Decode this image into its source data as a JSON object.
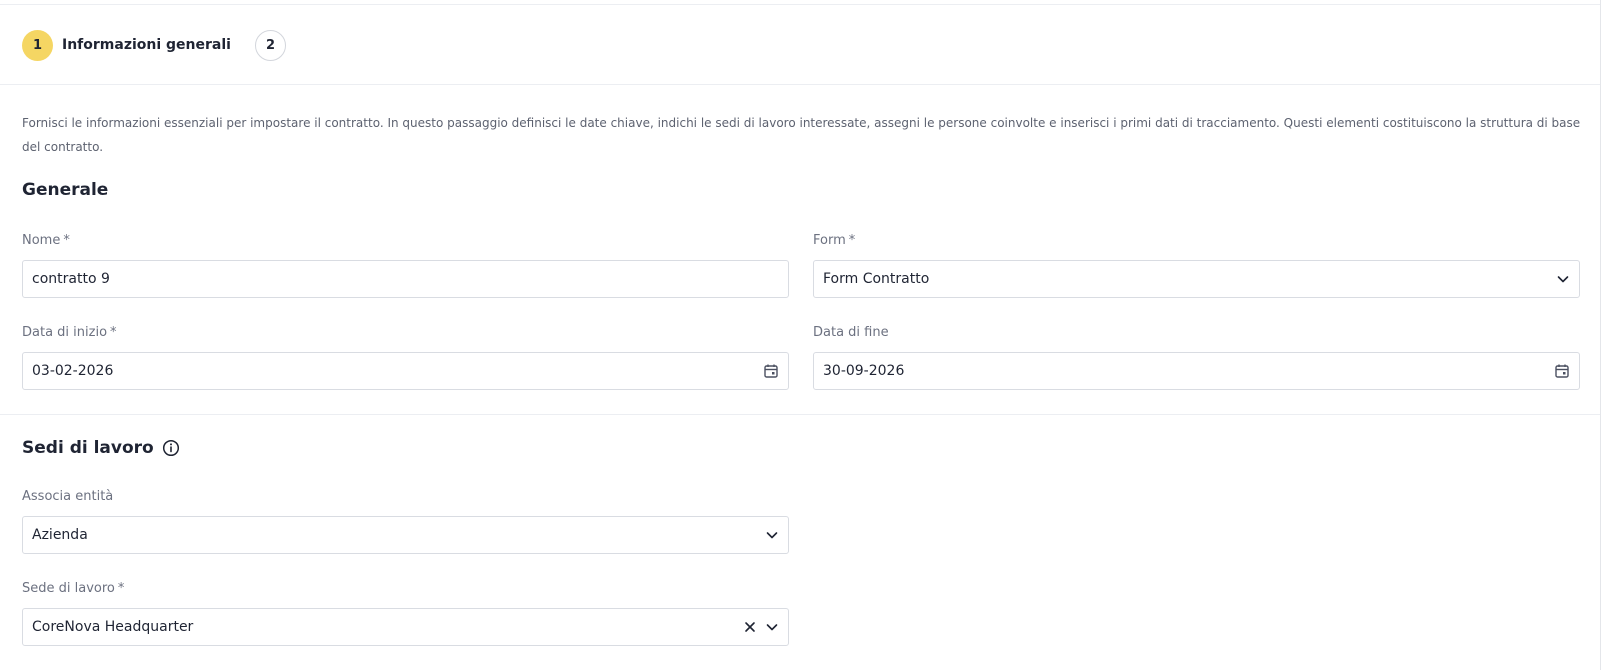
{
  "stepper": {
    "steps": [
      {
        "number": "1",
        "label": "Informazioni generali"
      },
      {
        "number": "2"
      }
    ]
  },
  "intro_text": "Fornisci le informazioni essenziali per impostare il contratto. In questo passaggio definisci le date chiave, indichi le sedi di lavoro interessate, assegni le persone coinvolte e inserisci i primi dati di tracciamento. Questi elementi costituiscono la struttura di base del contratto.",
  "general": {
    "title": "Generale",
    "nome": {
      "label": "Nome",
      "required": "*",
      "value": "contratto 9"
    },
    "form": {
      "label": "Form",
      "required": "*",
      "value": "Form Contratto",
      "icon": "chevron-down-icon"
    },
    "data_inizio": {
      "label": "Data di inizio",
      "required": "*",
      "value": "03-02-2026",
      "icon": "calendar-icon"
    },
    "data_fine": {
      "label": "Data di fine",
      "value": "30-09-2026",
      "icon": "calendar-icon"
    }
  },
  "work_sites": {
    "title": "Sedi di lavoro",
    "title_icon": "info-icon",
    "associa_entita": {
      "label": "Associa entità",
      "value": "Azienda",
      "icon": "chevron-down-icon"
    },
    "sede": {
      "label": "Sede di lavoro",
      "required": "*",
      "value": "CoreNova Headquarter",
      "icons": [
        "clear-icon",
        "chevron-down-icon"
      ]
    }
  },
  "colors": {
    "active_step": "#f5d663",
    "border": "#d9dce2",
    "text": "#1f2433",
    "muted": "#6c7180"
  }
}
